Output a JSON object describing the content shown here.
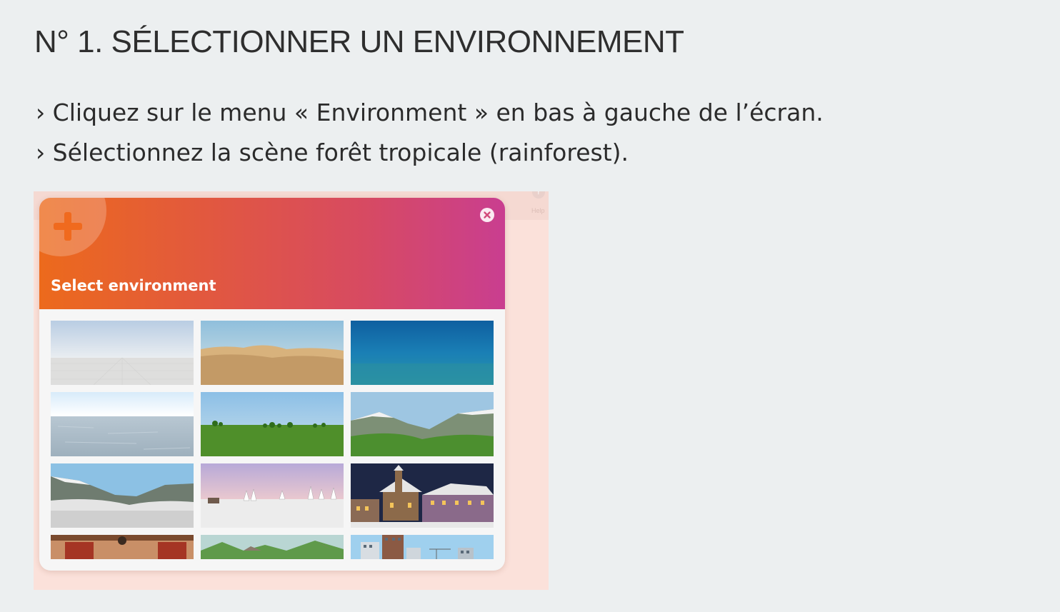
{
  "heading": "N° 1. SÉLECTIONNER UN ENVIRONNEMENT",
  "instructions": [
    "› Cliquez sur le menu « Environment » en bas à gauche de l’écran.",
    "› Sélectionnez la scène forêt tropicale (rainforest)."
  ],
  "screenshot": {
    "background_help_label": "Help",
    "modal": {
      "title": "Select environment",
      "header_gradient": [
        "#ec6a1c",
        "#c93e90"
      ],
      "header_icon": "plus-icon",
      "close_icon": "close-icon",
      "environments": [
        {
          "scene": "empty-grid"
        },
        {
          "scene": "desert"
        },
        {
          "scene": "underwater"
        },
        {
          "scene": "frozen-sea"
        },
        {
          "scene": "grass-field"
        },
        {
          "scene": "mountain-valley"
        },
        {
          "scene": "snowy-valley"
        },
        {
          "scene": "winter-forest"
        },
        {
          "scene": "snowy-village-night"
        },
        {
          "scene": "indoor-room"
        },
        {
          "scene": "rocky-hills"
        },
        {
          "scene": "city"
        }
      ]
    }
  }
}
